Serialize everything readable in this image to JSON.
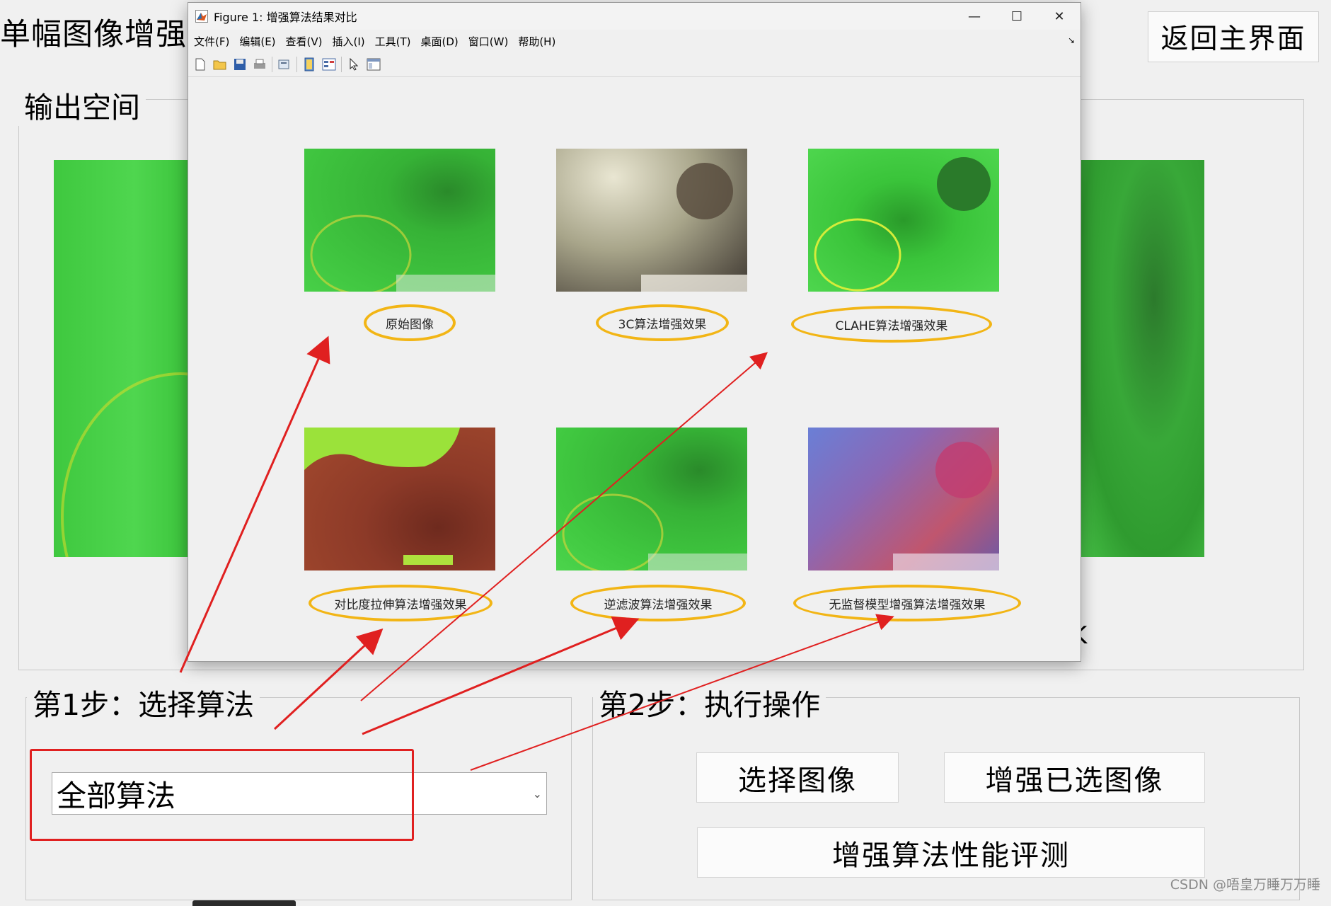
{
  "app": {
    "title": "单幅图像增强分",
    "back_button": "返回主界面",
    "output_panel_title": "输出空间",
    "step1_title": "第1步：选择算法",
    "step2_title": "第2步：执行操作",
    "algorithm_select_value": "全部算法",
    "buttons": {
      "select_image": "选择图像",
      "enhance_selected": "增强已选图像",
      "evaluate": "增强算法性能评测"
    },
    "edge_char": "K",
    "watermark": "CSDN @唔皇万睡万万睡"
  },
  "figure": {
    "title": "Figure 1: 增强算法结果对比",
    "menu": [
      "文件(F)",
      "编辑(E)",
      "查看(V)",
      "插入(I)",
      "工具(T)",
      "桌面(D)",
      "窗口(W)",
      "帮助(H)"
    ],
    "toolbar_icons": [
      "new-file-icon",
      "open-folder-icon",
      "save-icon",
      "print-icon",
      "print-preview-icon",
      "link-axes-icon",
      "insert-colorbar-icon",
      "pointer-icon",
      "property-editor-icon"
    ],
    "window_controls": [
      "minimize-icon",
      "maximize-icon",
      "close-icon"
    ],
    "results": [
      {
        "label": "原始图像",
        "tone": "green"
      },
      {
        "label": "3C算法增强效果",
        "tone": "neutral"
      },
      {
        "label": "CLAHE算法增强效果",
        "tone": "bright-green"
      },
      {
        "label": "对比度拉伸算法增强效果",
        "tone": "red"
      },
      {
        "label": "逆滤波算法增强效果",
        "tone": "green"
      },
      {
        "label": "无监督模型增强算法增强效果",
        "tone": "purple"
      }
    ]
  },
  "colors": {
    "annotation_red": "#e02020",
    "highlight_orange": "#f2b515"
  }
}
